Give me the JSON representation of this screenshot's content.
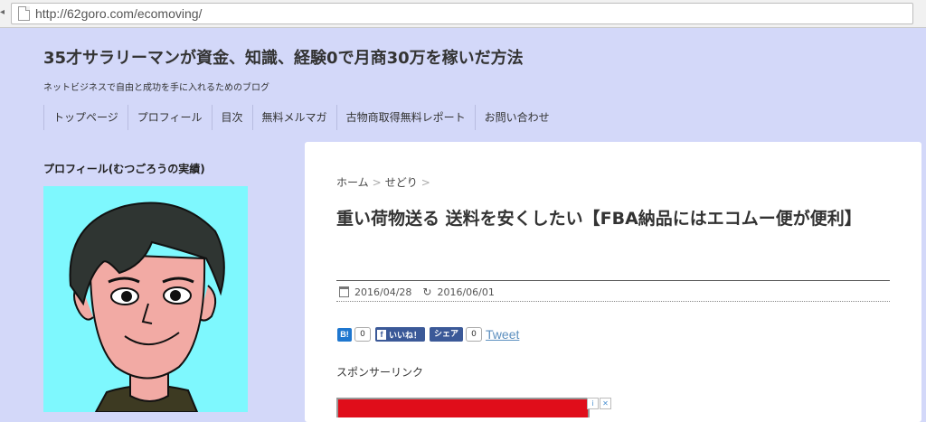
{
  "browser": {
    "url": "http://62goro.com/ecomoving/"
  },
  "site": {
    "title": "35才サラリーマンが資金、知識、経験0で月商30万を稼いだ方法",
    "description": "ネットビジネスで自由と成功を手に入れるためのブログ"
  },
  "nav": {
    "items": [
      "トップページ",
      "プロフィール",
      "目次",
      "無料メルマガ",
      "古物商取得無料レポート",
      "お問い合わせ"
    ]
  },
  "sidebar": {
    "profile_heading": "プロフィール(むつごろうの実績)"
  },
  "post": {
    "breadcrumb": [
      "ホーム",
      "せどり"
    ],
    "title": "重い荷物送る 送料を安くしたい【FBA納品にはエコムー便が便利】",
    "published": "2016/04/28",
    "updated": "2016/06/01",
    "share": {
      "hatena_label": "B!",
      "hatena_count": "0",
      "like_label": "いいね！",
      "share_label": "シェア",
      "share_count": "0",
      "tweet_label": "Tweet"
    },
    "sponsor_label": "スポンサーリンク"
  },
  "colors": {
    "page_background": "#d3d8f9",
    "avatar_background": "#7ef8fe",
    "ad_banner": "#e00d1a"
  }
}
